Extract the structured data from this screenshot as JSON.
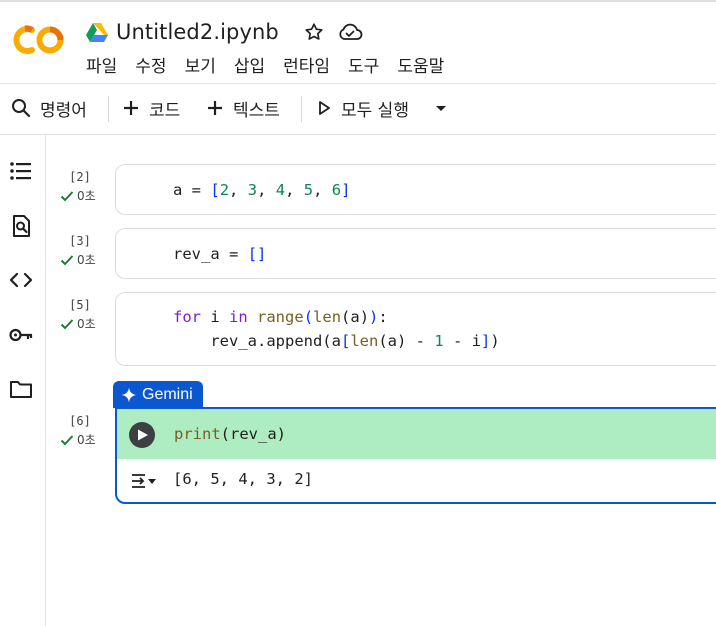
{
  "header": {
    "file_title": "Untitled2.ipynb",
    "menu": [
      "파일",
      "수정",
      "보기",
      "삽입",
      "런타임",
      "도구",
      "도움말"
    ]
  },
  "toolbar": {
    "command_label": "명령어",
    "code_label": "코드",
    "text_label": "텍스트",
    "run_all_label": "모두 실행"
  },
  "sidebar": {
    "items": [
      "table-of-contents-icon",
      "find-icon",
      "code-snippets-icon",
      "secrets-key-icon",
      "files-folder-icon"
    ]
  },
  "cells": [
    {
      "count": "[2]",
      "duration": "0초"
    },
    {
      "count": "[3]",
      "duration": "0초"
    },
    {
      "count": "[5]",
      "duration": "0초"
    },
    {
      "count": "[6]",
      "duration": "0초",
      "output": "[6, 5, 4, 3, 2]"
    }
  ],
  "gemini": {
    "label": "Gemini"
  },
  "colors": {
    "accent": "#0b57d0",
    "active_cell_bg": "#aeecc1",
    "success_check": "#188038",
    "logo_orange": "#f9ab00",
    "logo_orange_dark": "#e8710a"
  }
}
